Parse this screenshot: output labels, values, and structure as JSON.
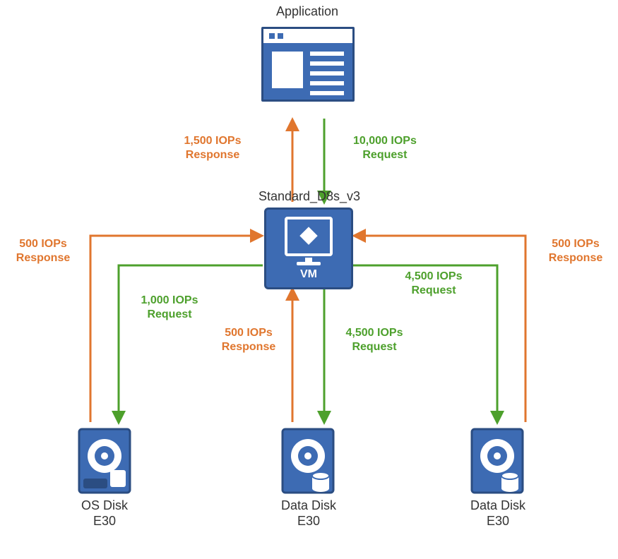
{
  "title_app": "Application",
  "title_vm": "Standard_D8s_v3",
  "vm_caption": "VM",
  "disks": {
    "os": {
      "name": "OS Disk",
      "tier": "E30"
    },
    "data1": {
      "name": "Data Disk",
      "tier": "E30"
    },
    "data2": {
      "name": "Data Disk",
      "tier": "E30"
    }
  },
  "flows": {
    "app_to_vm_request": {
      "l1": "10,000 IOPs",
      "l2": "Request"
    },
    "vm_to_app_response": {
      "l1": "1,500 IOPs",
      "l2": "Response"
    },
    "vm_to_os_request": {
      "l1": "1,000 IOPs",
      "l2": "Request"
    },
    "os_to_vm_response": {
      "l1": "500 IOPs",
      "l2": "Response"
    },
    "vm_to_d1_request": {
      "l1": "4,500 IOPs",
      "l2": "Request"
    },
    "d1_to_vm_response": {
      "l1": "500 IOPs",
      "l2": "Response"
    },
    "vm_to_d2_request": {
      "l1": "4,500 IOPs",
      "l2": "Request"
    },
    "d2_to_vm_response": {
      "l1": "500 IOPs",
      "l2": "Response"
    }
  },
  "colors": {
    "request": "#4da02c",
    "response": "#e0762e",
    "block_fill": "#3d6bb3",
    "block_border": "#2b4d82"
  }
}
